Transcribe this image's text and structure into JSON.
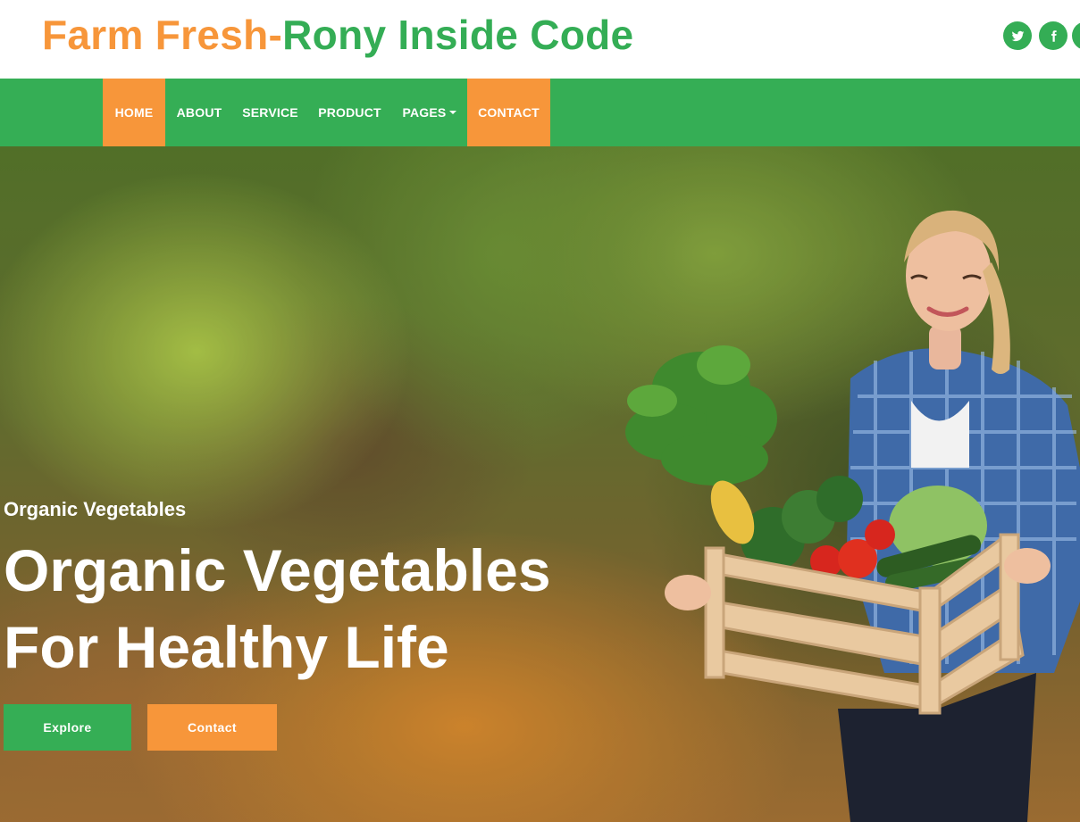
{
  "brand": {
    "part1": "Farm Fresh-",
    "part2": "Rony Inside Code"
  },
  "social": [
    {
      "icon": "twitter-icon"
    },
    {
      "icon": "facebook-icon"
    },
    {
      "icon": "social-icon"
    }
  ],
  "nav": {
    "items": [
      {
        "label": "HOME",
        "active": true
      },
      {
        "label": "ABOUT",
        "active": false
      },
      {
        "label": "SERVICE",
        "active": false
      },
      {
        "label": "PRODUCT",
        "active": false
      },
      {
        "label": "PAGES",
        "active": false,
        "dropdown": true
      },
      {
        "label": "CONTACT",
        "active": true
      }
    ]
  },
  "hero": {
    "subtitle": "Organic Vegetables",
    "title_line1": "Organic Vegetables",
    "title_line2": "For Healthy Life",
    "buttons": {
      "explore": "Explore",
      "contact": "Contact"
    }
  },
  "colors": {
    "green": "#35ae55",
    "orange": "#f7963a"
  }
}
